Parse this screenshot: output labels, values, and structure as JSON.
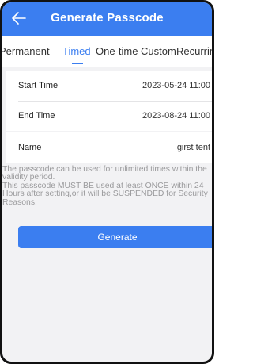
{
  "header": {
    "title": "Generate Passcode"
  },
  "tabs": [
    "Permanent",
    "Timed",
    "One-time",
    "Custom",
    "Recurring"
  ],
  "form": {
    "start_label": "Start Time",
    "start_value": "2023-05-24 11:00",
    "end_label": "End Time",
    "end_value": "2023-08-24 11:00",
    "name_label": "Name",
    "name_value": "girst tent"
  },
  "info_lines": [
    "The passcode can be used for unlimited times within the",
    "validity period.",
    "This passcode MUST BE used at least ONCE within 24",
    "Hours after setting,or it will be SUSPENDED for Security",
    "Reasons."
  ],
  "generate_label": "Generate",
  "colors": {
    "accent": "#3b7ef0",
    "muted_text": "#9a9a9c"
  },
  "icons": {
    "back": "arrow-left-icon"
  }
}
